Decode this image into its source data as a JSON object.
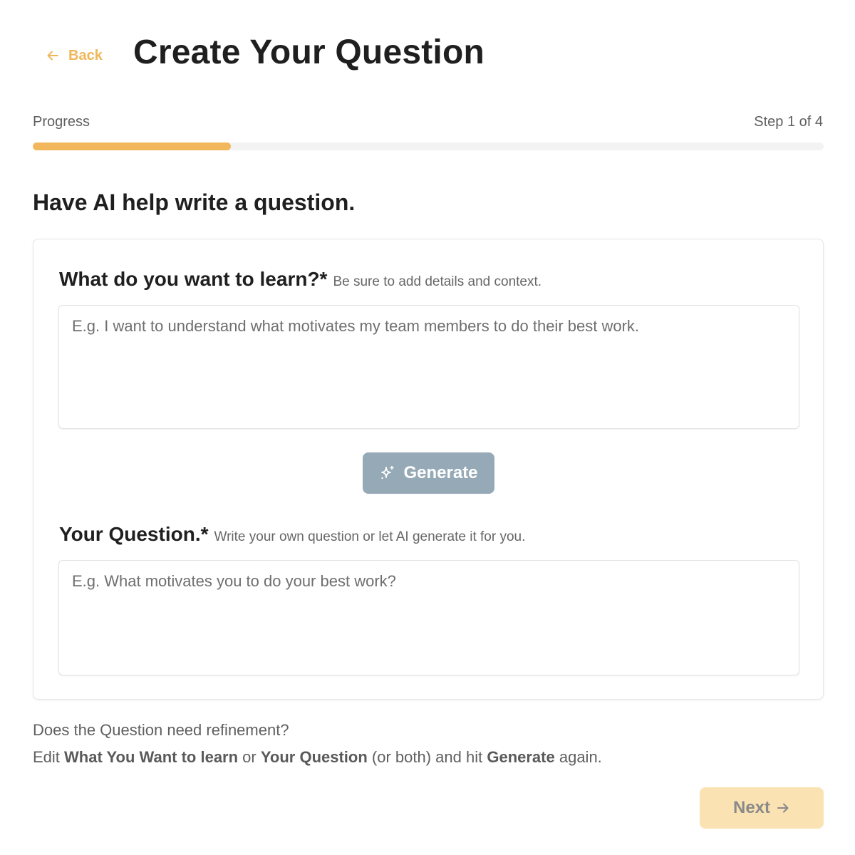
{
  "header": {
    "back_label": "Back",
    "title": "Create Your Question"
  },
  "progress": {
    "label": "Progress",
    "step_text": "Step 1 of 4",
    "fraction": 0.25
  },
  "section": {
    "heading": "Have AI help write a question."
  },
  "learn_field": {
    "label": "What do you want to learn?*",
    "hint": "Be sure to add details and context.",
    "value": "",
    "placeholder": "E.g. I want to understand what motivates my team members to do their best work."
  },
  "generate": {
    "label": "Generate",
    "icon": "sparkle-icon"
  },
  "question_field": {
    "label": "Your Question.*",
    "hint": "Write your own question or let AI generate it for you.",
    "value": "",
    "placeholder": "E.g. What motivates you to do your best work?"
  },
  "help": {
    "line1": "Does the Question need refinement?",
    "line2_part1": "Edit ",
    "line2_bold1": "What You Want to learn",
    "line2_part2": " or ",
    "line2_bold2": "Your Question",
    "line2_part3": " (or both) and hit ",
    "line2_bold3": "Generate",
    "line2_part4": " again."
  },
  "next": {
    "label": "Next",
    "icon": "arrow-right-icon"
  },
  "colors": {
    "accent": "#f2b75c",
    "back_link": "#f0b65a",
    "generate_bg": "#95a9b6",
    "next_bg": "#fbe2b2",
    "progress_track": "#f3f3f3"
  }
}
